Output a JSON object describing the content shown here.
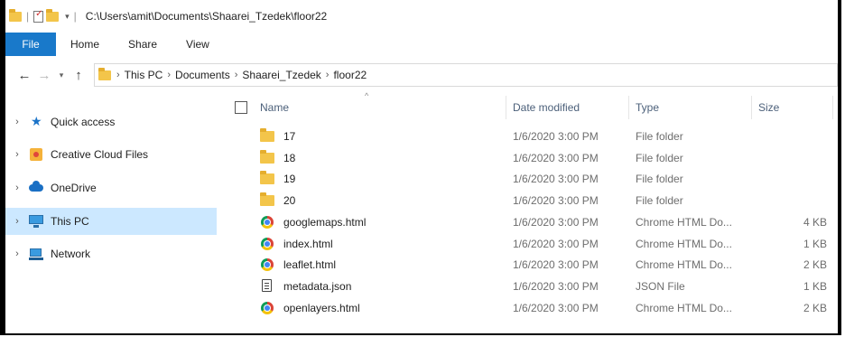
{
  "window": {
    "title_path": "C:\\Users\\amit\\Documents\\Shaarei_Tzedek\\floor22"
  },
  "ribbon": {
    "tabs": [
      "File",
      "Home",
      "Share",
      "View"
    ]
  },
  "address": {
    "breadcrumbs": [
      "This PC",
      "Documents",
      "Shaarei_Tzedek",
      "floor22"
    ]
  },
  "nav": {
    "items": [
      {
        "label": "Quick access",
        "icon": "quick-access-star-icon",
        "selected": false
      },
      {
        "label": "Creative Cloud Files",
        "icon": "creative-cloud-icon",
        "selected": false
      },
      {
        "label": "OneDrive",
        "icon": "onedrive-cloud-icon",
        "selected": false
      },
      {
        "label": "This PC",
        "icon": "this-pc-icon",
        "selected": true
      },
      {
        "label": "Network",
        "icon": "network-icon",
        "selected": false
      }
    ]
  },
  "columns": {
    "name": "Name",
    "date": "Date modified",
    "type": "Type",
    "size": "Size"
  },
  "files": [
    {
      "name": "17",
      "date": "1/6/2020 3:00 PM",
      "type": "File folder",
      "size": "",
      "icon": "folder-icon"
    },
    {
      "name": "18",
      "date": "1/6/2020 3:00 PM",
      "type": "File folder",
      "size": "",
      "icon": "folder-icon"
    },
    {
      "name": "19",
      "date": "1/6/2020 3:00 PM",
      "type": "File folder",
      "size": "",
      "icon": "folder-icon"
    },
    {
      "name": "20",
      "date": "1/6/2020 3:00 PM",
      "type": "File folder",
      "size": "",
      "icon": "folder-icon"
    },
    {
      "name": "googlemaps.html",
      "date": "1/6/2020 3:00 PM",
      "type": "Chrome HTML Do...",
      "size": "4 KB",
      "icon": "chrome-icon"
    },
    {
      "name": "index.html",
      "date": "1/6/2020 3:00 PM",
      "type": "Chrome HTML Do...",
      "size": "1 KB",
      "icon": "chrome-icon"
    },
    {
      "name": "leaflet.html",
      "date": "1/6/2020 3:00 PM",
      "type": "Chrome HTML Do...",
      "size": "2 KB",
      "icon": "chrome-icon"
    },
    {
      "name": "metadata.json",
      "date": "1/6/2020 3:00 PM",
      "type": "JSON File",
      "size": "1 KB",
      "icon": "json-file-icon"
    },
    {
      "name": "openlayers.html",
      "date": "1/6/2020 3:00 PM",
      "type": "Chrome HTML Do...",
      "size": "2 KB",
      "icon": "chrome-icon"
    }
  ],
  "colors": {
    "file_tab": "#1979ca",
    "selected_nav": "#cce8ff",
    "folder": "#f3c54a"
  }
}
